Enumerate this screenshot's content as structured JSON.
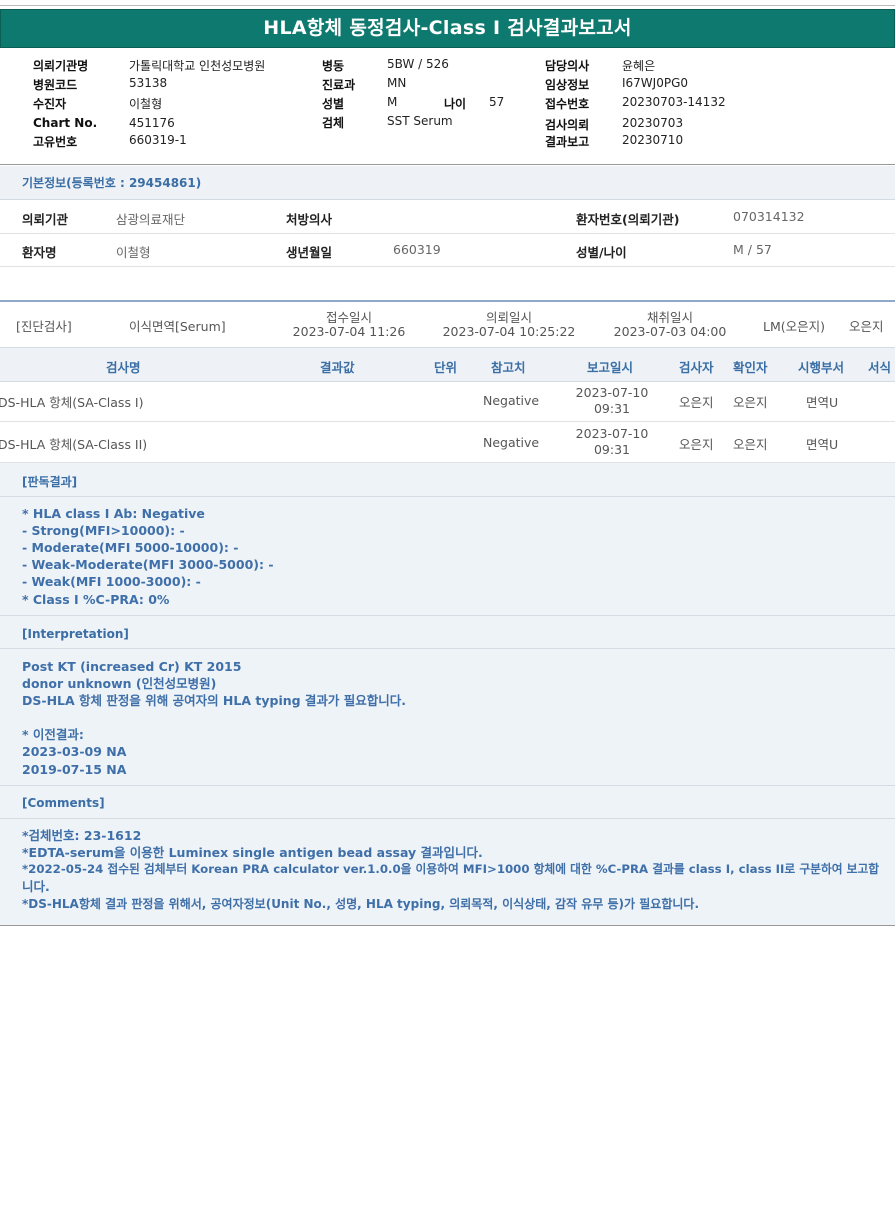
{
  "title": "HLA항체 동정검사-Class I 검사결과보고서",
  "header": {
    "institution_label": "의뢰기관명",
    "institution": "가톨릭대학교 인천성모병원",
    "hospital_code_label": "병원코드",
    "hospital_code": "53138",
    "examinee_label": "수진자",
    "examinee": "이철형",
    "chart_label": "Chart No.",
    "chart": "451176",
    "unique_label": "고유번호",
    "unique": "660319-1",
    "ward_label": "병동",
    "ward": "5BW / 526",
    "dept_label": "진료과",
    "dept": "MN",
    "sex_label": "성별",
    "sex": "M",
    "age_label": "나이",
    "age": "57",
    "specimen_label": "검체",
    "specimen": "SST Serum",
    "doctor_label": "담당의사",
    "doctor": "윤혜은",
    "clinical_label": "임상정보",
    "clinical": "I67WJ0PG0",
    "receipt_label": "접수번호",
    "receipt": "20230703-14132",
    "request_label": "검사의뢰",
    "request": "20230703",
    "report_label": "결과보고",
    "report": "20230710"
  },
  "basic": {
    "heading": "기본정보(등록번호 : 29454861)",
    "req_inst_label": "의뢰기관",
    "req_inst": "삼광의료재단",
    "prescriber_label": "처방의사",
    "prescriber": "",
    "patient_no_label": "환자번호(의뢰기관)",
    "patient_no": "070314132",
    "patient_name_label": "환자명",
    "patient_name": "이철형",
    "dob_label": "생년월일",
    "dob": "660319",
    "sex_age_label": "성별/나이",
    "sex_age": "M / 57"
  },
  "diagnosis": {
    "category": "[진단검사]",
    "test": "이식면역[Serum]",
    "received_label": "접수일시",
    "received": "2023-07-04 11:26",
    "requested_label": "의뢰일시",
    "requested": "2023-07-04 10:25:22",
    "collected_label": "채취일시",
    "collected": "2023-07-03 04:00",
    "lm": "LM(오은지)",
    "staff": "오은지"
  },
  "columns": {
    "test_name": "검사명",
    "result": "결과값",
    "unit": "단위",
    "reference": "참고치",
    "report_date": "보고일시",
    "tester": "검사자",
    "verifier": "확인자",
    "dept": "시행부서",
    "form": "서식"
  },
  "results": [
    {
      "name": "DS-HLA 항체(SA-Class I)",
      "reference": "Negative",
      "date": "2023-07-10",
      "time": "09:31",
      "tester": "오은지",
      "verifier": "오은지",
      "dept": "면역U"
    },
    {
      "name": "DS-HLA 항체(SA-Class II)",
      "reference": "Negative",
      "date": "2023-07-10",
      "time": "09:31",
      "tester": "오은지",
      "verifier": "오은지",
      "dept": "면역U"
    }
  ],
  "reading": {
    "heading": "[판독결과]",
    "lines": [
      "* HLA class I Ab: Negative",
      "- Strong(MFI>10000): -",
      "- Moderate(MFI 5000-10000): -",
      "- Weak-Moderate(MFI 3000-5000): -",
      "- Weak(MFI 1000-3000): -",
      "* Class I %C-PRA: 0%"
    ]
  },
  "interpretation": {
    "heading": "[Interpretation]",
    "lines": [
      "Post KT (increased Cr) KT 2015",
      "donor unknown (인천성모병원)",
      "DS-HLA 항체 판정을 위해 공여자의 HLA typing 결과가 필요합니다.",
      "",
      "* 이전결과:",
      "2023-03-09 NA",
      "2019-07-15 NA"
    ]
  },
  "comments": {
    "heading": "[Comments]",
    "lines": [
      "*검체번호: 23-1612",
      "*EDTA-serum을 이용한 Luminex single antigen bead assay 결과입니다.",
      "*2022-05-24 접수된 검체부터 Korean PRA calculator ver.1.0.0을 이용하여 MFI>1000 항체에 대한 %C-PRA 결과를 class I, class II로 구분하여 보고합",
      "니다.",
      "*DS-HLA항체 결과 판정을 위해서, 공여자정보(Unit No., 성명, HLA typing, 의뢰목적, 이식상태, 감작 유무 등)가 필요합니다."
    ]
  }
}
